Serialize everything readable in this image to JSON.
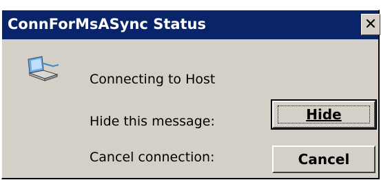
{
  "window": {
    "title": "ConnForMsASync Status",
    "close_glyph": "✕"
  },
  "icon": {
    "name": "network-connection-icon"
  },
  "message": {
    "status": "Connecting to Host",
    "hide_prompt": "Hide this message:",
    "cancel_prompt": "Cancel connection:"
  },
  "buttons": {
    "hide_label": "Hide",
    "cancel_label": "Cancel"
  },
  "colors": {
    "titlebar": "#0a246a",
    "dialog_face": "#d4d0c8"
  }
}
